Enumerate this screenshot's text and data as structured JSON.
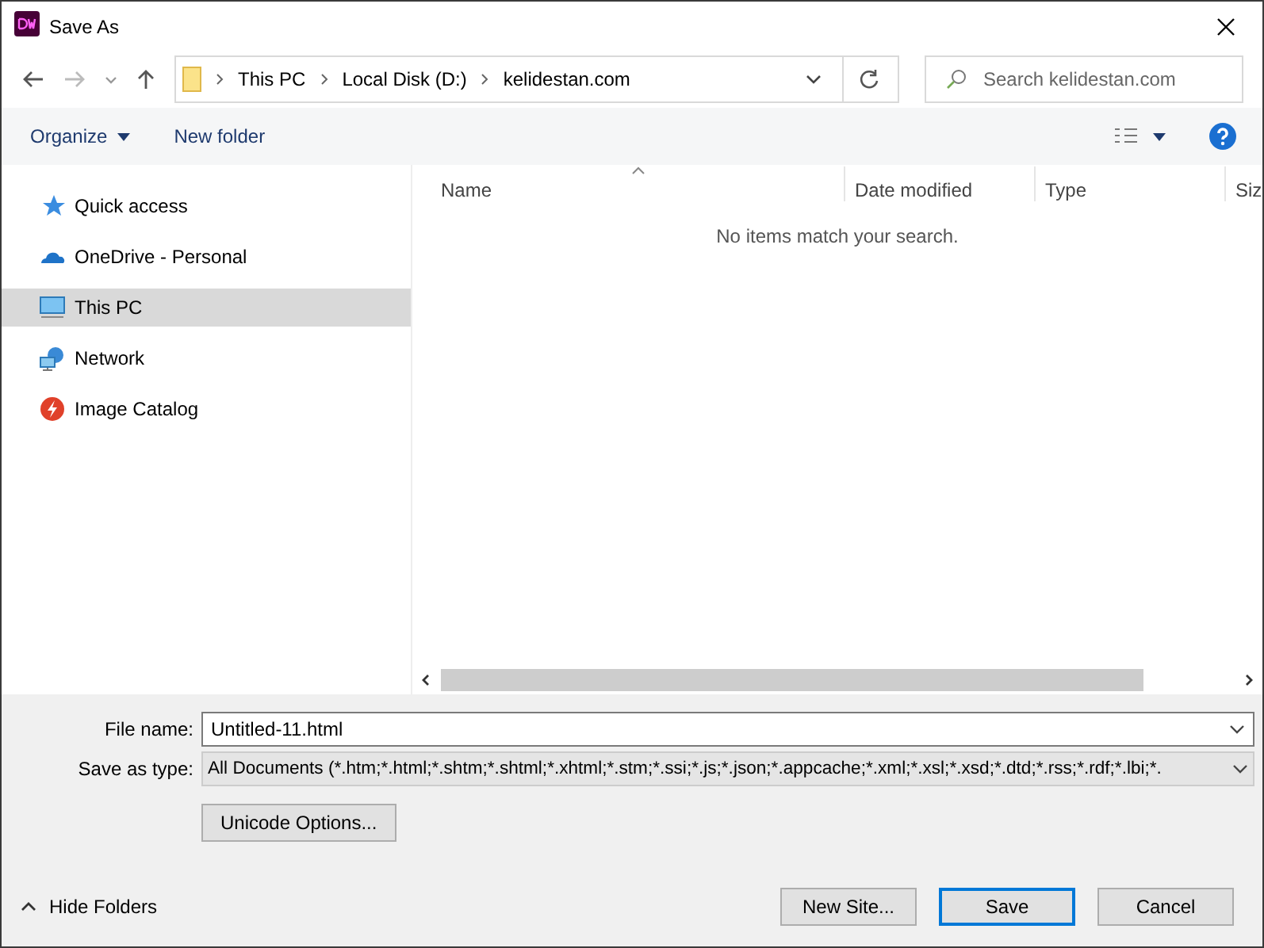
{
  "window": {
    "title": "Save As"
  },
  "address": {
    "crumbs": [
      "This PC",
      "Local Disk (D:)",
      "kelidestan.com"
    ]
  },
  "search": {
    "placeholder": "Search kelidestan.com"
  },
  "toolbar": {
    "organize": "Organize",
    "new_folder": "New folder"
  },
  "sidebar": {
    "items": [
      {
        "label": "Quick access",
        "kind": "star",
        "selected": false
      },
      {
        "label": "OneDrive - Personal",
        "kind": "cloud",
        "selected": false
      },
      {
        "label": "This PC",
        "kind": "pc",
        "selected": true
      },
      {
        "label": "Network",
        "kind": "network",
        "selected": false
      },
      {
        "label": "Image Catalog",
        "kind": "catalog",
        "selected": false
      }
    ]
  },
  "table": {
    "columns": [
      "Name",
      "Date modified",
      "Type",
      "Siz"
    ],
    "empty_message": "No items match your search."
  },
  "form": {
    "file_name_label": "File name:",
    "file_name": "Untitled-11.html",
    "type_label": "Save as type:",
    "type_value": "All Documents (*.htm;*.html;*.shtm;*.shtml;*.xhtml;*.stm;*.ssi;*.js;*.json;*.appcache;*.xml;*.xsl;*.xsd;*.dtd;*.rss;*.rdf;*.lbi;*.",
    "unicode_button": "Unicode Options..."
  },
  "footer": {
    "hide_folders": "Hide Folders",
    "buttons": [
      {
        "label": "New Site...",
        "default": false
      },
      {
        "label": "Save",
        "default": true
      },
      {
        "label": "Cancel",
        "default": false
      }
    ]
  }
}
